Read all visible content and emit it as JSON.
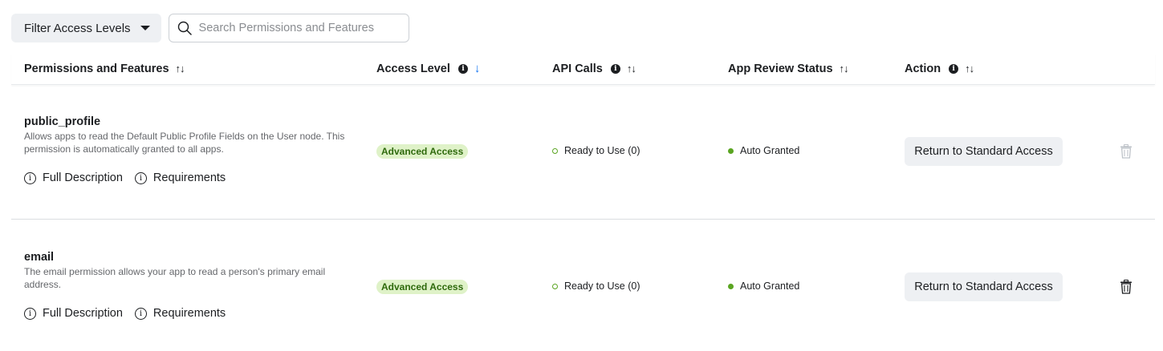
{
  "toolbar": {
    "filter_label": "Filter Access Levels",
    "search_placeholder": "Search Permissions and Features"
  },
  "columns": {
    "permissions": "Permissions and Features",
    "access_level": "Access Level",
    "api_calls": "API Calls",
    "review_status": "App Review Status",
    "action": "Action"
  },
  "rows": [
    {
      "name": "public_profile",
      "description": "Allows apps to read the Default Public Profile Fields on the User node. This permission is automatically granted to all apps.",
      "full_description_label": "Full Description",
      "requirements_label": "Requirements",
      "access_badge": "Advanced Access",
      "api_calls": "Ready to Use (0)",
      "review_status": "Auto Granted",
      "action_label": "Return to Standard Access",
      "trash_enabled": false
    },
    {
      "name": "email",
      "description": "The email permission allows your app to read a person's primary email address.",
      "full_description_label": "Full Description",
      "requirements_label": "Requirements",
      "access_badge": "Advanced Access",
      "api_calls": "Ready to Use (0)",
      "review_status": "Auto Granted",
      "action_label": "Return to Standard Access",
      "trash_enabled": true
    }
  ],
  "colors": {
    "badge_bg": "#dff2c8",
    "badge_text": "#2f6a0d",
    "status_green": "#5aa521",
    "sort_active": "#1877f2"
  }
}
